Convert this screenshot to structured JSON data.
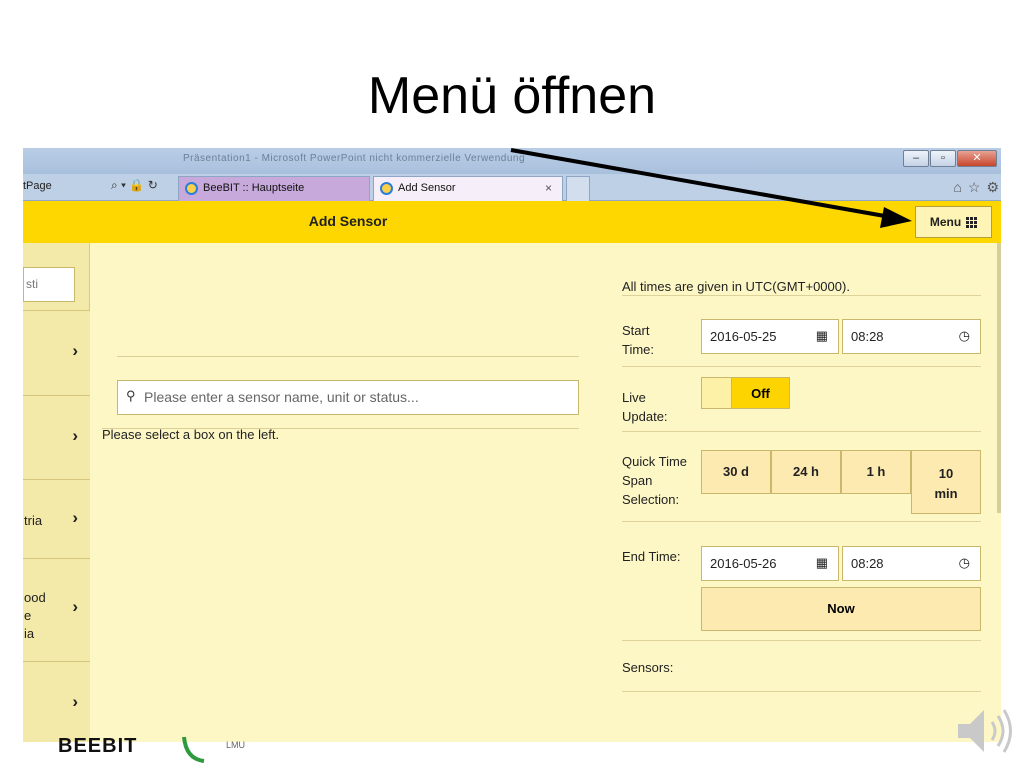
{
  "slide": {
    "title": "Menü öffnen"
  },
  "browser": {
    "window_title": "Präsentation1 - Microsoft PowerPoint nicht kommerzielle Verwendung",
    "address_text": "tPage",
    "address_tools": "⌕ ▾ 🔒 ↻",
    "tabs": [
      {
        "label": "BeeBIT :: Hauptseite"
      },
      {
        "label": "Add Sensor",
        "close": "×"
      }
    ],
    "window_buttons": {
      "minimize": "–",
      "restore": "▫",
      "close": "✕"
    },
    "icons": {
      "home": "⌂",
      "star": "☆",
      "gear": "⚙"
    }
  },
  "app": {
    "title": "Add Sensor",
    "menu_label": "Menu",
    "menu_icon": "grid-icon"
  },
  "sidebar": {
    "search_value": "sti",
    "items": [
      {
        "label": ""
      },
      {
        "label": ""
      },
      {
        "label": "tria"
      },
      {
        "label": "ood\ne\nia"
      },
      {
        "label": ""
      }
    ],
    "chevron": "›"
  },
  "main": {
    "search_placeholder": "Please enter a sensor name, unit or status...",
    "select_message": "Please select a box on the left."
  },
  "time_panel": {
    "utc_note": "All times are given in UTC(GMT+0000).",
    "start_label": "Start Time:",
    "start_date": "2016-05-25",
    "start_time": "08:28",
    "live_update_label": "Live Update:",
    "live_update_state": "Off",
    "quick_span_label": "Quick Time Span Selection:",
    "quick_spans": [
      "30 d",
      "24 h",
      "1 h",
      "10 min"
    ],
    "end_label": "End Time:",
    "end_date": "2016-05-26",
    "end_time": "08:28",
    "now_label": "Now",
    "sensors_label": "Sensors:"
  },
  "footer": {
    "logo_left": "BEEBIT",
    "logo_right": "LMU"
  },
  "colors": {
    "app_bar": "#ffd700",
    "page_bg": "#fdf7c6",
    "sidebar_bg": "#f3e9a8",
    "button_bg": "#fceab0",
    "toggle_on": "#fdd400"
  }
}
